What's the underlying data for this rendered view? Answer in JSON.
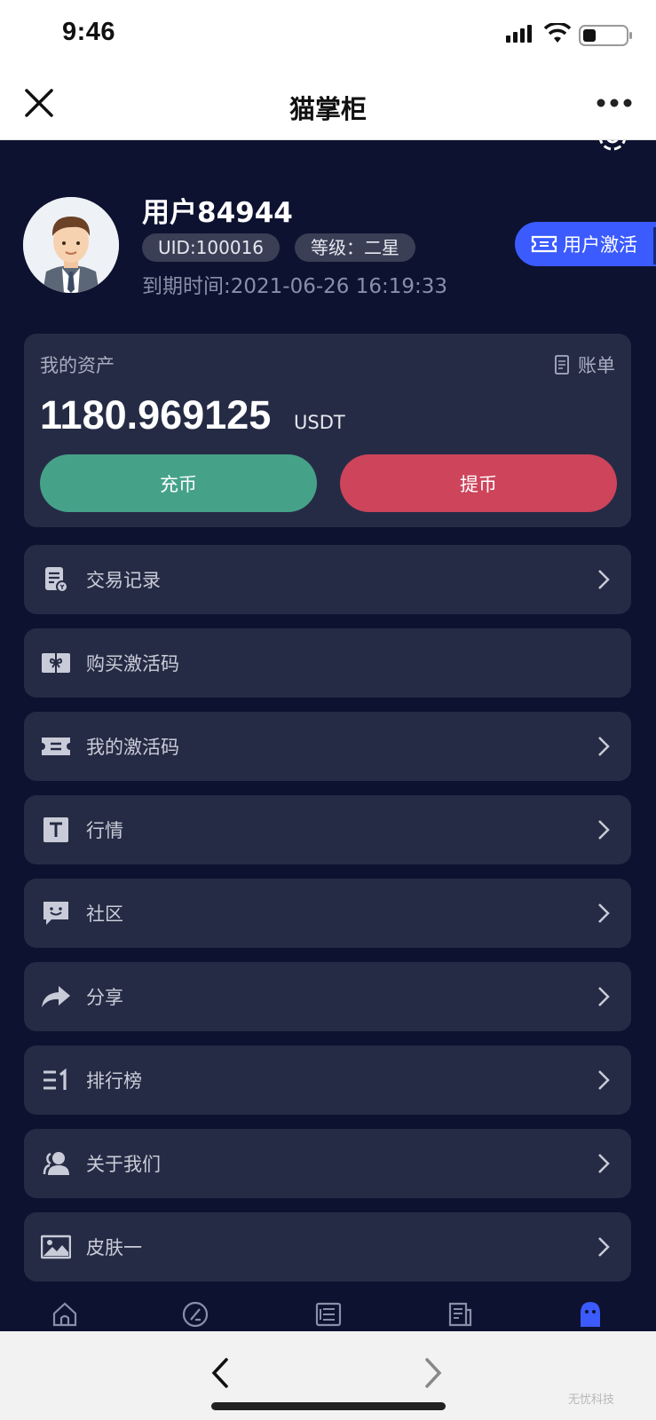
{
  "status_bar": {
    "time": "9:46"
  },
  "nav": {
    "title": "猫掌柜"
  },
  "profile": {
    "username": "用户84944",
    "uid": "UID:100016",
    "level": "等级：二星",
    "expire": "到期时间:2021-06-26 16:19:33",
    "activate_label": "用户激活"
  },
  "assets": {
    "title": "我的资产",
    "bill_label": "账单",
    "amount": "1180.969125",
    "unit": "USDT",
    "deposit_label": "充币",
    "withdraw_label": "提币"
  },
  "menu": [
    {
      "label": "交易记录",
      "icon": "transaction-record-icon",
      "chevron": true
    },
    {
      "label": "购买激活码",
      "icon": "buy-code-icon",
      "chevron": false
    },
    {
      "label": "我的激活码",
      "icon": "ticket-icon",
      "chevron": true
    },
    {
      "label": "行情",
      "icon": "market-icon",
      "chevron": true
    },
    {
      "label": "社区",
      "icon": "community-icon",
      "chevron": true
    },
    {
      "label": "分享",
      "icon": "share-icon",
      "chevron": true
    },
    {
      "label": "排行榜",
      "icon": "ranking-icon",
      "chevron": true
    },
    {
      "label": "关于我们",
      "icon": "about-icon",
      "chevron": true
    },
    {
      "label": "皮肤一",
      "icon": "skin-icon",
      "chevron": true
    }
  ],
  "tabs": [
    "home-icon",
    "discover-icon",
    "list-icon",
    "news-icon",
    "profile-icon"
  ],
  "browser": {
    "watermark": "无忧科技"
  },
  "colors": {
    "background": "#0d1230",
    "card": "#262b45",
    "accent_blue": "#3b5bff",
    "deposit_green": "#45a289",
    "withdraw_red": "#cd445b"
  }
}
